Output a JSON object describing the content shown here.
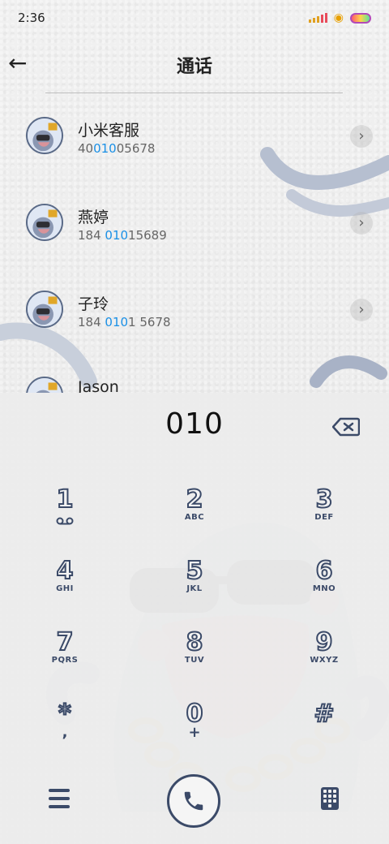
{
  "status_bar": {
    "time": "2:36"
  },
  "header": {
    "title": "通话"
  },
  "contacts": [
    {
      "name": "小米客服",
      "number_pre": "40",
      "number_match": "010",
      "number_post": "05678"
    },
    {
      "name": "燕婷",
      "number_pre": "184 ",
      "number_match": "010",
      "number_post": "15689"
    },
    {
      "name": "子玲",
      "number_pre": "184 ",
      "number_match": "010",
      "number_post": "1 5678"
    },
    {
      "name": "Jason",
      "number_pre": "",
      "number_match": "",
      "number_post": ""
    }
  ],
  "dialer": {
    "input": "010",
    "keys": [
      {
        "digit": "1",
        "letters": ""
      },
      {
        "digit": "2",
        "letters": "ABC"
      },
      {
        "digit": "3",
        "letters": "DEF"
      },
      {
        "digit": "4",
        "letters": "GHI"
      },
      {
        "digit": "5",
        "letters": "JKL"
      },
      {
        "digit": "6",
        "letters": "MNO"
      },
      {
        "digit": "7",
        "letters": "PQRS"
      },
      {
        "digit": "8",
        "letters": "TUV"
      },
      {
        "digit": "9",
        "letters": "WXYZ"
      },
      {
        "digit": "*",
        "letters": ","
      },
      {
        "digit": "0",
        "letters": "+"
      },
      {
        "digit": "#",
        "letters": ""
      }
    ]
  },
  "icons": {
    "back": "back-arrow-icon",
    "chevron": "chevron-right-icon",
    "backspace": "backspace-icon",
    "voicemail": "voicemail-icon",
    "menu": "menu-icon",
    "call": "phone-icon",
    "keypad": "keypad-icon"
  },
  "colors": {
    "accent": "#1a90e6",
    "ink": "#3b4a68"
  }
}
